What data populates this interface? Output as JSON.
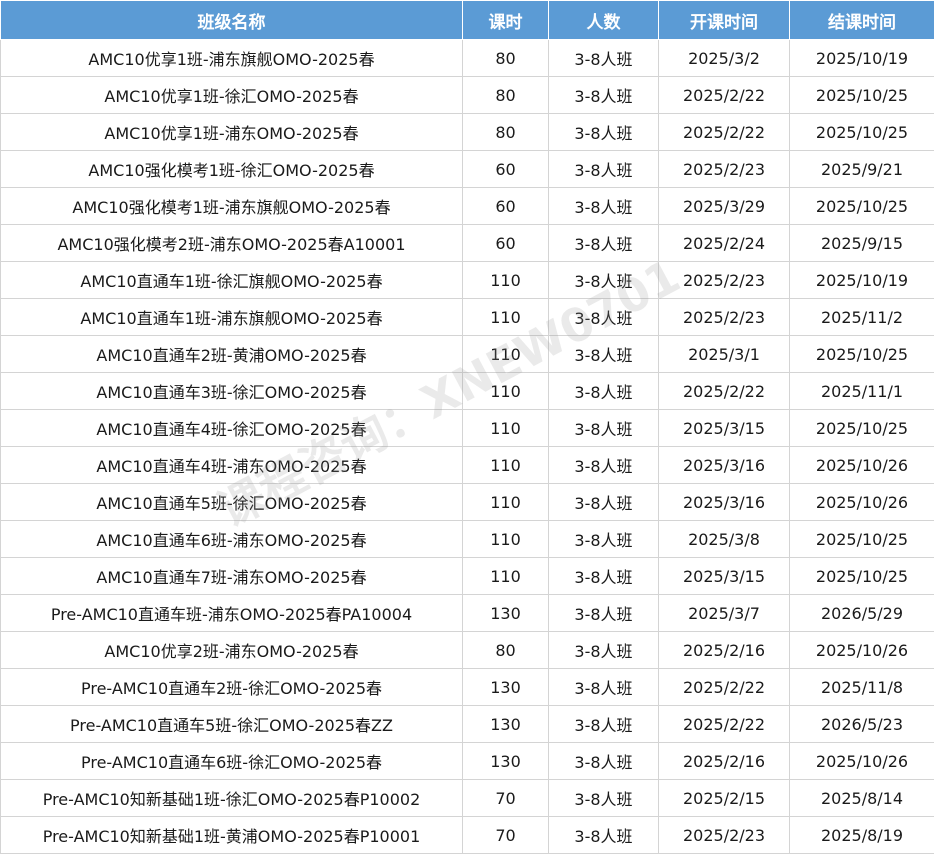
{
  "header": {
    "name": "班级名称",
    "hours": "课时",
    "size": "人数",
    "start": "开课时间",
    "end": "结课时间"
  },
  "rows": [
    {
      "name": "AMC10优享1班-浦东旗舰OMO-2025春",
      "hours": "80",
      "size": "3-8人班",
      "start": "2025/3/2",
      "end": "2025/10/19"
    },
    {
      "name": "AMC10优享1班-徐汇OMO-2025春",
      "hours": "80",
      "size": "3-8人班",
      "start": "2025/2/22",
      "end": "2025/10/25"
    },
    {
      "name": "AMC10优享1班-浦东OMO-2025春",
      "hours": "80",
      "size": "3-8人班",
      "start": "2025/2/22",
      "end": "2025/10/25"
    },
    {
      "name": "AMC10强化模考1班-徐汇OMO-2025春",
      "hours": "60",
      "size": "3-8人班",
      "start": "2025/2/23",
      "end": "2025/9/21"
    },
    {
      "name": "AMC10强化模考1班-浦东旗舰OMO-2025春",
      "hours": "60",
      "size": "3-8人班",
      "start": "2025/3/29",
      "end": "2025/10/25"
    },
    {
      "name": "AMC10强化模考2班-浦东OMO-2025春A10001",
      "hours": "60",
      "size": "3-8人班",
      "start": "2025/2/24",
      "end": "2025/9/15"
    },
    {
      "name": "AMC10直通车1班-徐汇旗舰OMO-2025春",
      "hours": "110",
      "size": "3-8人班",
      "start": "2025/2/23",
      "end": "2025/10/19"
    },
    {
      "name": "AMC10直通车1班-浦东旗舰OMO-2025春",
      "hours": "110",
      "size": "3-8人班",
      "start": "2025/2/23",
      "end": "2025/11/2"
    },
    {
      "name": "AMC10直通车2班-黄浦OMO-2025春",
      "hours": "110",
      "size": "3-8人班",
      "start": "2025/3/1",
      "end": "2025/10/25"
    },
    {
      "name": "AMC10直通车3班-徐汇OMO-2025春",
      "hours": "110",
      "size": "3-8人班",
      "start": "2025/2/22",
      "end": "2025/11/1"
    },
    {
      "name": "AMC10直通车4班-徐汇OMO-2025春",
      "hours": "110",
      "size": "3-8人班",
      "start": "2025/3/15",
      "end": "2025/10/25"
    },
    {
      "name": "AMC10直通车4班-浦东OMO-2025春",
      "hours": "110",
      "size": "3-8人班",
      "start": "2025/3/16",
      "end": "2025/10/26"
    },
    {
      "name": "AMC10直通车5班-徐汇OMO-2025春",
      "hours": "110",
      "size": "3-8人班",
      "start": "2025/3/16",
      "end": "2025/10/26"
    },
    {
      "name": "AMC10直通车6班-浦东OMO-2025春",
      "hours": "110",
      "size": "3-8人班",
      "start": "2025/3/8",
      "end": "2025/10/25"
    },
    {
      "name": "AMC10直通车7班-浦东OMO-2025春",
      "hours": "110",
      "size": "3-8人班",
      "start": "2025/3/15",
      "end": "2025/10/25"
    },
    {
      "name": "Pre-AMC10直通车班-浦东OMO-2025春PA10004",
      "hours": "130",
      "size": "3-8人班",
      "start": "2025/3/7",
      "end": "2026/5/29"
    },
    {
      "name": "AMC10优享2班-浦东OMO-2025春",
      "hours": "80",
      "size": "3-8人班",
      "start": "2025/2/16",
      "end": "2025/10/26"
    },
    {
      "name": "Pre-AMC10直通车2班-徐汇OMO-2025春",
      "hours": "130",
      "size": "3-8人班",
      "start": "2025/2/22",
      "end": "2025/11/8"
    },
    {
      "name": "Pre-AMC10直通车5班-徐汇OMO-2025春ZZ",
      "hours": "130",
      "size": "3-8人班",
      "start": "2025/2/22",
      "end": "2026/5/23"
    },
    {
      "name": "Pre-AMC10直通车6班-徐汇OMO-2025春",
      "hours": "130",
      "size": "3-8人班",
      "start": "2025/2/16",
      "end": "2025/10/26"
    },
    {
      "name": "Pre-AMC10知新基础1班-徐汇OMO-2025春P10002",
      "hours": "70",
      "size": "3-8人班",
      "start": "2025/2/15",
      "end": "2025/8/14"
    },
    {
      "name": "Pre-AMC10知新基础1班-黄浦OMO-2025春P10001",
      "hours": "70",
      "size": "3-8人班",
      "start": "2025/2/23",
      "end": "2025/8/19"
    }
  ],
  "watermark": "课程咨询：XNEW0701",
  "colors": {
    "header_bg": "#5b9bd5",
    "header_text": "#ffffff",
    "grid_line": "#d4d4d4"
  }
}
